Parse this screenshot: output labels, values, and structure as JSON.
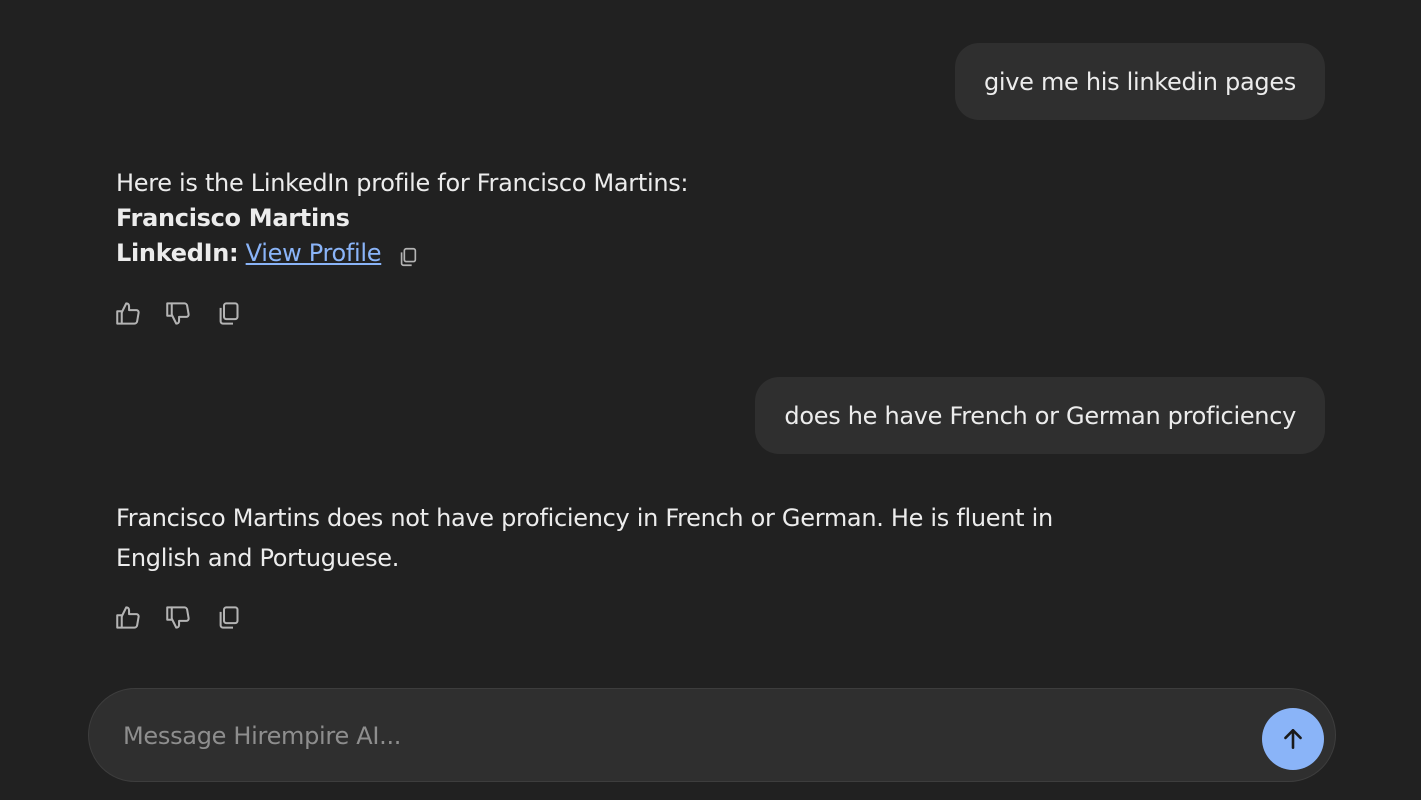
{
  "conversation": {
    "messages": [
      {
        "role": "user",
        "text": "give me his linkedin pages"
      },
      {
        "role": "assistant",
        "intro": "Here is the LinkedIn profile for Francisco Martins:",
        "name": "Francisco Martins",
        "linkedin_label": "LinkedIn:",
        "link_text": "View Profile"
      },
      {
        "role": "user",
        "text": "does he have French or German proficiency"
      },
      {
        "role": "assistant",
        "text": "Francisco Martins does not have proficiency in French or German. He is fluent in English and Portuguese."
      }
    ]
  },
  "icons": {
    "like": "thumbs-up-icon",
    "dislike": "thumbs-down-icon",
    "copy": "copy-icon",
    "send": "arrow-up-icon"
  },
  "composer": {
    "placeholder": "Message Hirempire AI...",
    "value": ""
  },
  "colors": {
    "background": "#212121",
    "bubble": "#2f2f2f",
    "link": "#8ab4f8",
    "send_button": "#8ab4f8"
  }
}
